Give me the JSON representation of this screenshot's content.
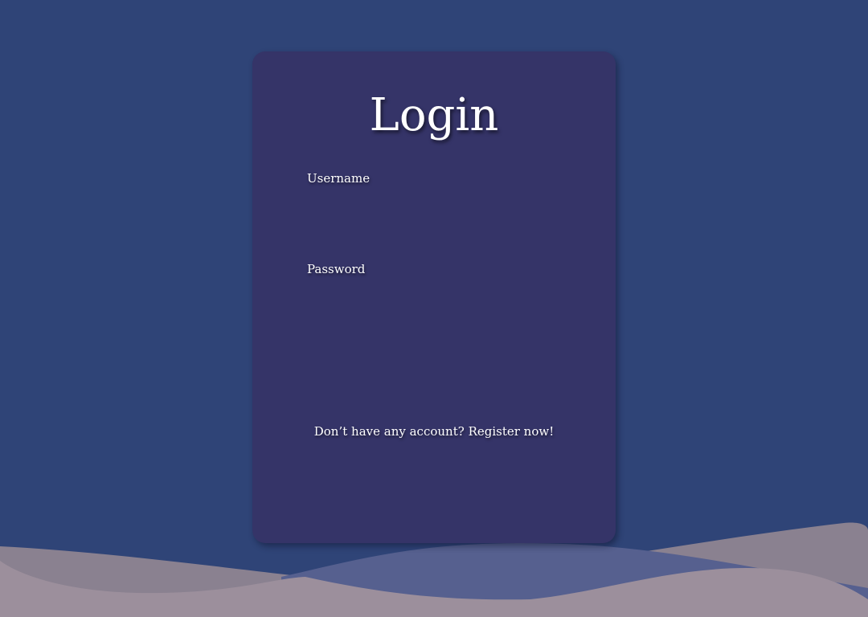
{
  "login": {
    "title": "Login",
    "username_label": "Username",
    "username_value": "",
    "password_label": "Password",
    "password_value": "",
    "register_prompt": "Don’t have any account?",
    "register_link": "Register now!"
  },
  "colors": {
    "background": "#2f4477",
    "card": "#353468",
    "text": "#ffffff",
    "wave_back": "#8a8190",
    "wave_mid": "#56608f",
    "wave_front": "#9c8f9c"
  }
}
